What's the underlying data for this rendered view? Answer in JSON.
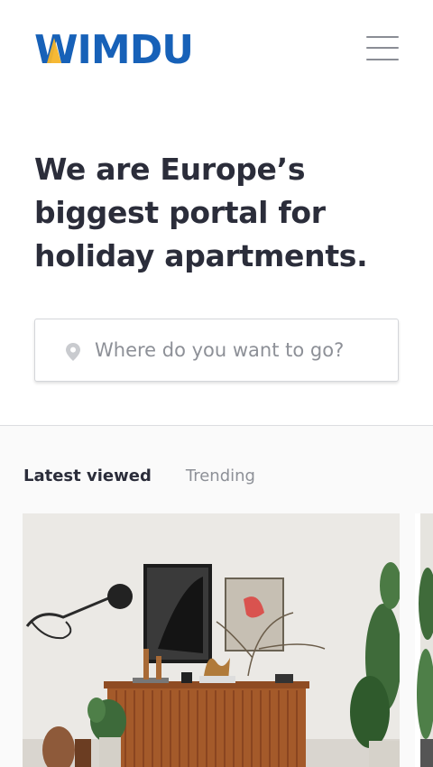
{
  "brand": {
    "name": "WIMDU",
    "colors": {
      "blue": "#1761b8",
      "yellow": "#f5b52a",
      "text": "#2b2d3a",
      "muted": "#8d9097"
    }
  },
  "header": {
    "menu_icon": "hamburger-menu-icon"
  },
  "hero": {
    "title": "We are Europe’s biggest portal for holiday apartments."
  },
  "search": {
    "placeholder": "Where do you want to go?",
    "value": "",
    "icon": "map-pin-icon"
  },
  "section": {
    "tabs": [
      {
        "label": "Latest viewed",
        "active": true
      },
      {
        "label": "Trending",
        "active": false
      }
    ]
  },
  "cards": [
    {
      "image": "apartment-interior-photo"
    },
    {
      "image": "apartment-interior-photo-partial"
    }
  ]
}
